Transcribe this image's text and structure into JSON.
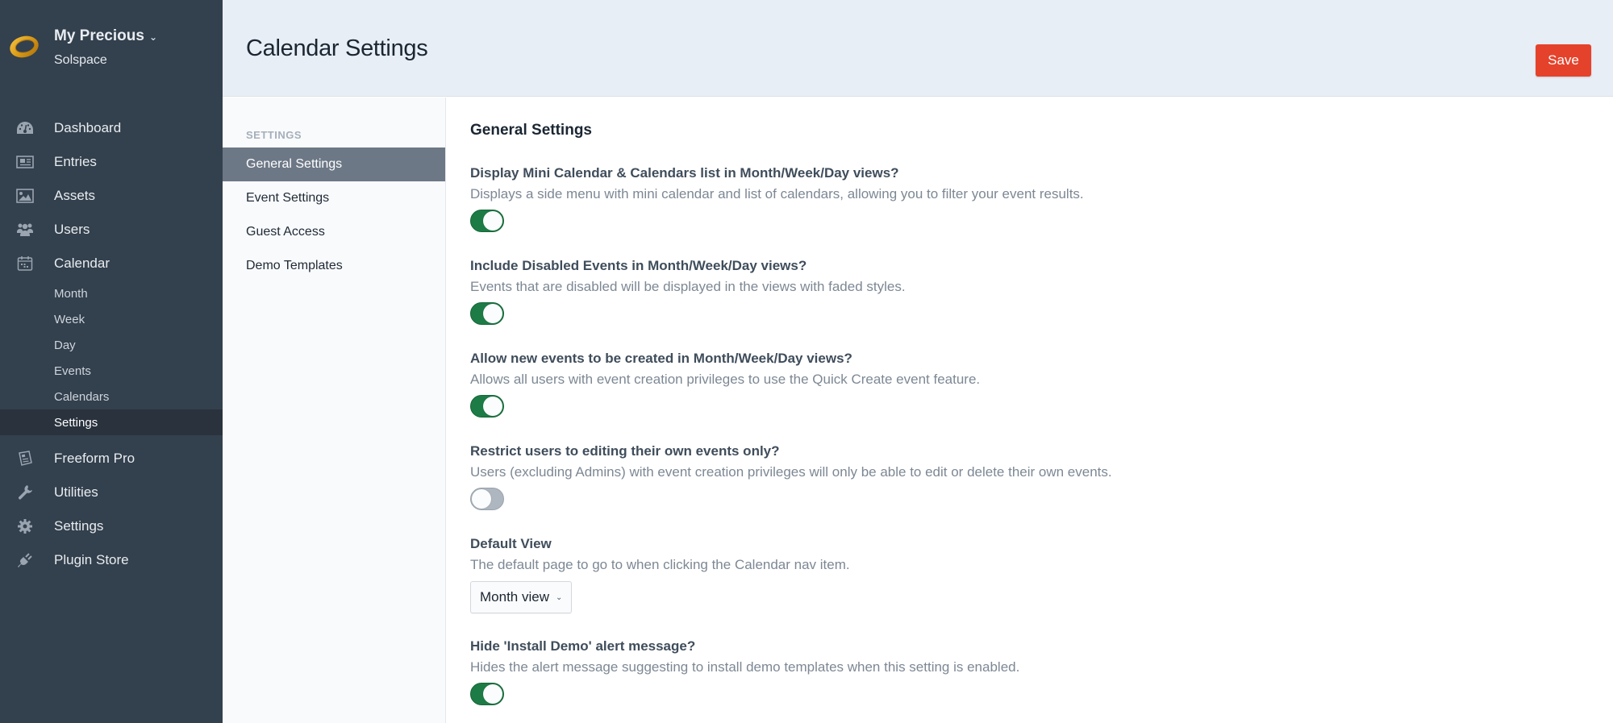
{
  "site": {
    "name": "My Precious",
    "subtitle": "Solspace",
    "logo_icon": "gold-ring-logo",
    "chevron": "⌄"
  },
  "nav": {
    "items": [
      {
        "label": "Dashboard",
        "icon": "gauge-icon"
      },
      {
        "label": "Entries",
        "icon": "newspaper-icon"
      },
      {
        "label": "Assets",
        "icon": "image-icon"
      },
      {
        "label": "Users",
        "icon": "users-icon"
      },
      {
        "label": "Calendar",
        "icon": "calendar-icon"
      }
    ],
    "calendar_subitems": [
      {
        "label": "Month"
      },
      {
        "label": "Week"
      },
      {
        "label": "Day"
      },
      {
        "label": "Events"
      },
      {
        "label": "Calendars"
      },
      {
        "label": "Settings",
        "active": true
      }
    ],
    "bottom_items": [
      {
        "label": "Freeform Pro",
        "icon": "freeform-icon"
      },
      {
        "label": "Utilities",
        "icon": "wrench-icon"
      },
      {
        "label": "Settings",
        "icon": "gear-icon"
      },
      {
        "label": "Plugin Store",
        "icon": "plug-icon"
      }
    ]
  },
  "header": {
    "title": "Calendar Settings",
    "save_label": "Save",
    "save_color": "#e5422b"
  },
  "settings_nav": {
    "heading": "SETTINGS",
    "items": [
      {
        "label": "General Settings",
        "active": true
      },
      {
        "label": "Event Settings"
      },
      {
        "label": "Guest Access"
      },
      {
        "label": "Demo Templates"
      }
    ]
  },
  "main": {
    "section_title": "General Settings",
    "fields": [
      {
        "label": "Display Mini Calendar & Calendars list in Month/Week/Day views?",
        "description": "Displays a side menu with mini calendar and list of calendars, allowing you to filter your event results.",
        "type": "toggle",
        "value": true
      },
      {
        "label": "Include Disabled Events in Month/Week/Day views?",
        "description": "Events that are disabled will be displayed in the views with faded styles.",
        "type": "toggle",
        "value": true
      },
      {
        "label": "Allow new events to be created in Month/Week/Day views?",
        "description": "Allows all users with event creation privileges to use the Quick Create event feature.",
        "type": "toggle",
        "value": true
      },
      {
        "label": "Restrict users to editing their own events only?",
        "description": "Users (excluding Admins) with event creation privileges will only be able to edit or delete their own events.",
        "type": "toggle",
        "value": false
      },
      {
        "label": "Default View",
        "description": "The default page to go to when clicking the Calendar nav item.",
        "type": "select",
        "value": "Month view"
      },
      {
        "label": "Hide 'Install Demo' alert message?",
        "description": "Hides the alert message suggesting to install demo templates when this setting is enabled.",
        "type": "toggle",
        "value": true
      }
    ]
  },
  "colors": {
    "sidebar_bg": "#33404d",
    "toggle_on": "#1d7c46",
    "toggle_off": "#aeb6bf",
    "active_settings_item": "#6d7886"
  }
}
